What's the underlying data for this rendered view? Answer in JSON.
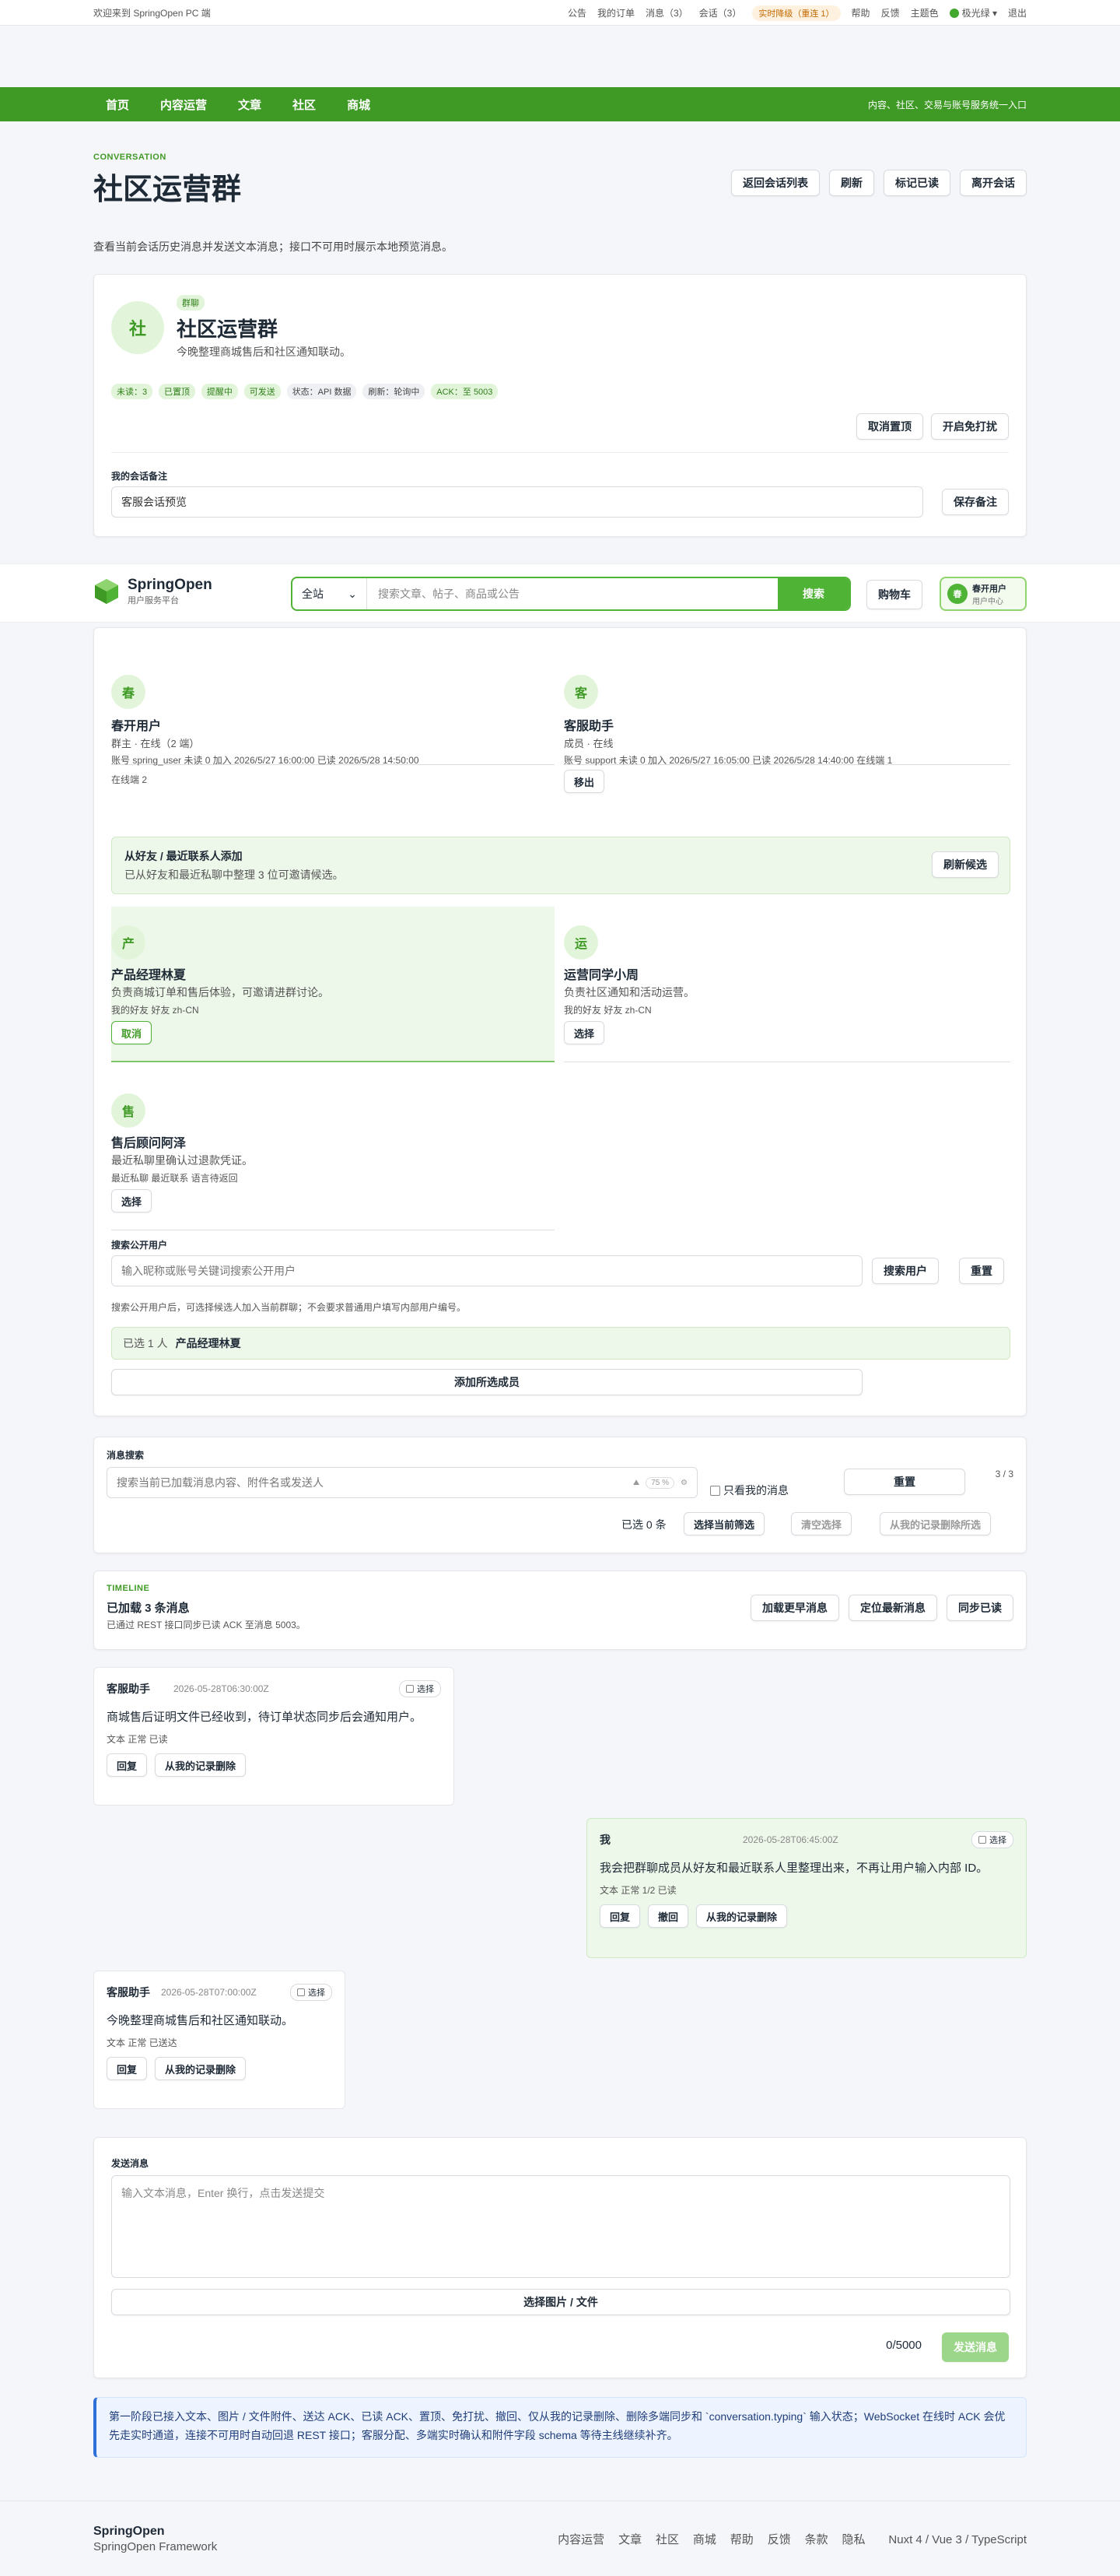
{
  "topbar": {
    "welcome": "欢迎来到 SpringOpen PC 端",
    "links": [
      "公告",
      "我的订单",
      "消息（3）",
      "会话（3）"
    ],
    "warn": "实时降级（重连 1）",
    "links2": [
      "帮助",
      "反馈",
      "主题色"
    ],
    "user": "极光绿",
    "logout": "退出"
  },
  "nav": {
    "items": [
      "首页",
      "内容运营",
      "文章",
      "社区",
      "商城"
    ],
    "slogan": "内容、社区、交易与账号服务统一入口"
  },
  "header": {
    "eyebrow": "CONVERSATION",
    "title": "社区运营群",
    "desc": "查看当前会话历史消息并发送文本消息；接口不可用时展示本地预览消息。",
    "buttons": [
      "返回会话列表",
      "刷新",
      "标记已读",
      "离开会话"
    ]
  },
  "group": {
    "avatar": "社",
    "tag": "群聊",
    "name": "社区运营群",
    "desc": "今晚整理商城售后和社区通知联动。",
    "chips": [
      "未读：3",
      "已置顶",
      "提醒中",
      "可发送",
      "状态：API 数据",
      "刷新：轮询中",
      "ACK：至 5003"
    ],
    "btn_unpin": "取消置顶",
    "btn_dnd": "开启免打扰",
    "note_label": "我的会话备注",
    "note_value": "客服会话预览",
    "btn_save": "保存备注"
  },
  "brand": {
    "logo": "SpringOpen",
    "sub": "用户服务平台",
    "scope": "全站",
    "search_placeholder": "搜索文章、帖子、商品或公告",
    "search_btn": "搜索",
    "cart": "购物车",
    "user": "春开用户",
    "user_sub": "用户中心"
  },
  "members": [
    {
      "avatar": "春",
      "name": "春开用户",
      "role": "群主 · 在线（2 端）",
      "meta": "账号 spring_user  未读 0  加入 2026/5/27 16:00:00  已读 2026/5/28 14:50:00",
      "meta2": "在线端 2"
    },
    {
      "avatar": "客",
      "name": "客服助手",
      "role": "成员 · 在线",
      "meta": "账号 support  未读 0  加入 2026/5/27 16:05:00  已读 2026/5/28 14:40:00  在线端 1",
      "btn": "移出"
    }
  ],
  "invite": {
    "title": "从好友 / 最近联系人添加",
    "desc": "已从好友和最近私聊中整理 3 位可邀请候选。",
    "btn": "刷新候选"
  },
  "candidates": [
    {
      "avatar": "产",
      "name": "产品经理林夏",
      "desc": "负责商城订单和售后体验，可邀请进群讨论。",
      "tags": "我的好友  好友  zh-CN",
      "btn": "取消"
    },
    {
      "avatar": "运",
      "name": "运营同学小周",
      "desc": "负责社区通知和活动运营。",
      "tags": "我的好友  好友  zh-CN",
      "btn": "选择"
    },
    {
      "avatar": "售",
      "name": "售后顾问阿泽",
      "desc": "最近私聊里确认过退款凭证。",
      "tags": "最近私聊  最近联系  语言待返回",
      "btn": "选择"
    }
  ],
  "public_search": {
    "label": "搜索公开用户",
    "placeholder": "输入昵称或账号关键词搜索公开用户",
    "btn_search": "搜索用户",
    "btn_reset": "重置",
    "hint": "搜索公开用户后，可选择候选人加入当前群聊；不会要求普通用户填写内部用户编号。",
    "selected_prefix": "已选 1 人",
    "selected_name": "产品经理林夏",
    "btn_add": "添加所选成员"
  },
  "msg_search": {
    "label": "消息搜索",
    "placeholder": "搜索当前已加载消息内容、附件名或发送人",
    "zoom": "75",
    "only_mine": "只看我的消息",
    "btn_reset": "重置",
    "count": "3 / 3",
    "selected": "已选 0 条",
    "btn_select_filtered": "选择当前筛选",
    "btn_clear": "清空选择",
    "btn_delete": "从我的记录删除所选"
  },
  "timeline": {
    "eyebrow": "TIMELINE",
    "title": "已加载 3 条消息",
    "desc": "已通过 REST 接口同步已读 ACK 至消息 5003。",
    "btns": [
      "加载更早消息",
      "定位最新消息",
      "同步已读"
    ]
  },
  "messages": [
    {
      "sender": "客服助手",
      "time": "2026-05-28T06:30:00Z",
      "select": "选择",
      "text": "商城售后证明文件已经收到，待订单状态同步后会通知用户。",
      "meta": "文本  正常  已读",
      "btns": [
        "回复",
        "从我的记录删除"
      ]
    },
    {
      "sender": "我",
      "time": "2026-05-28T06:45:00Z",
      "select": "选择",
      "text": "我会把群聊成员从好友和最近联系人里整理出来，不再让用户输入内部 ID。",
      "meta": "文本  正常  1/2 已读",
      "btns": [
        "回复",
        "撤回",
        "从我的记录删除"
      ]
    },
    {
      "sender": "客服助手",
      "time": "2026-05-28T07:00:00Z",
      "select": "选择",
      "text": "今晚整理商城售后和社区通知联动。",
      "meta": "文本  正常  已送达",
      "btns": [
        "回复",
        "从我的记录删除"
      ]
    }
  ],
  "compose": {
    "label": "发送消息",
    "placeholder": "输入文本消息，Enter 换行，点击发送提交",
    "btn_file": "选择图片 / 文件",
    "counter": "0/5000",
    "btn_send": "发送消息"
  },
  "notice": "第一阶段已接入文本、图片 / 文件附件、送达 ACK、已读 ACK、置顶、免打扰、撤回、仅从我的记录删除、删除多端同步和 `conversation.typing` 输入状态；WebSocket 在线时 ACK 会优先走实时通道，连接不可用时自动回退 REST 接口；客服分配、多端实时确认和附件字段 schema 等待主线继续补齐。",
  "footer": {
    "brand": "SpringOpen",
    "sub": "SpringOpen Framework",
    "links": [
      "内容运营",
      "文章",
      "社区",
      "商城",
      "帮助",
      "反馈",
      "条款",
      "隐私"
    ],
    "tech": "Nuxt 4 / Vue 3 / TypeScript"
  }
}
